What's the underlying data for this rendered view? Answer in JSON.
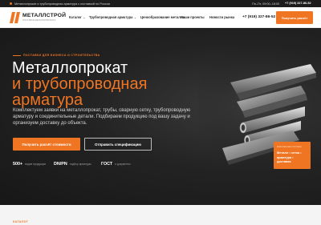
{
  "topbar": {
    "tagline": "Металлопрокат и трубопроводная арматура с поставкой по России",
    "hours": "Пн–Пт, 09:00–18:00",
    "phone": "+7 (919) 327-86-52"
  },
  "header": {
    "logo_title": "МЕТАЛЛСТРОЙ",
    "logo_subtitle": "ПОСТАВКИ МЕТАЛЛОПРОКАТА",
    "nav": [
      {
        "label": "Каталог",
        "has_dropdown": true
      },
      {
        "label": "Трубопроводная арматура",
        "has_dropdown": true
      },
      {
        "label": "Ценообразование металла",
        "has_dropdown": false
      },
      {
        "label": "Наши проекты",
        "has_dropdown": false
      },
      {
        "label": "Новости рынка",
        "has_dropdown": false
      }
    ],
    "phone": "+7 (919) 327-86-52",
    "cta": "Получить расчёт"
  },
  "hero": {
    "eyebrow": "ПОСТАВКИ ДЛЯ БИЗНЕСА И СТРОИТЕЛЬСТВА",
    "title_line1": "Металлопрокат",
    "title_line2": "и трубопроводная",
    "title_line3": "арматура",
    "lead": "Комплектуем заявки на металлопрокат, трубы, сварную сетку, трубопроводную арматуру и соединительные детали. Подбираем продукцию под вашу задачу и организуем доставку до объекта.",
    "primary_button": "Получить расчёт стоимости",
    "secondary_button": "Отправить спецификацию",
    "stats": [
      {
        "value": "500+",
        "label": "видов продукции"
      },
      {
        "value": "DN/PN",
        "label": "подбор арматуры"
      },
      {
        "value": "ГОСТ",
        "label": "и документы"
      }
    ],
    "card": {
      "caption": "Комплексная поставка",
      "text": "Металл • сетка • арматура • доставка"
    }
  },
  "bottom": {
    "section_label": "КАТАЛОГ"
  },
  "colors": {
    "accent": "#f07522",
    "dark": "#1c1c1c"
  },
  "icons": [
    "logo-mark-icon",
    "chevron-down-icon"
  ]
}
